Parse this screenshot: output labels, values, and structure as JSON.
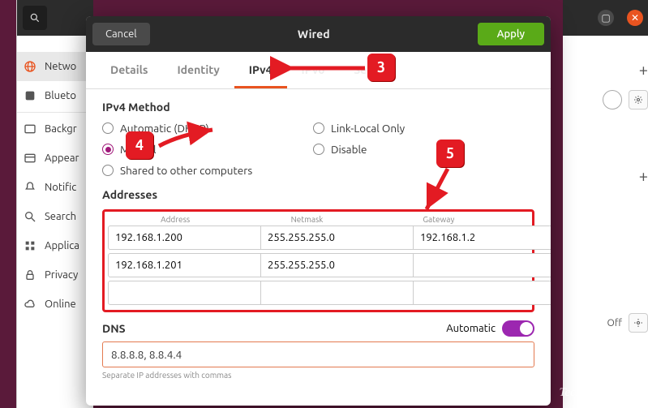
{
  "sidebar": {
    "items": [
      {
        "label": "Netwo",
        "icon": "globe"
      },
      {
        "label": "Blueto",
        "icon": "bluetooth"
      },
      {
        "label": "Backgr",
        "icon": "background"
      },
      {
        "label": "Appear",
        "icon": "appearance"
      },
      {
        "label": "Notific",
        "icon": "bell"
      },
      {
        "label": "Search",
        "icon": "search"
      },
      {
        "label": "Applica",
        "icon": "apps"
      },
      {
        "label": "Privacy",
        "icon": "lock"
      },
      {
        "label": "Online",
        "icon": "cloud"
      }
    ]
  },
  "dialog": {
    "cancel": "Cancel",
    "title": "Wired",
    "apply": "Apply"
  },
  "tabs": {
    "details": "Details",
    "identity": "Identity",
    "ipv4": "IPv4",
    "ipv6": "IPv6",
    "security": "Sec"
  },
  "ipv4": {
    "method_label": "IPv4 Method",
    "methods": {
      "auto": "Automatic (DHCP)",
      "link": "Link-Local Only",
      "manual": "Manual",
      "disable": "Disable",
      "shared": "Shared to other computers"
    },
    "addresses_label": "Addresses",
    "columns": {
      "address": "Address",
      "netmask": "Netmask",
      "gateway": "Gateway"
    },
    "rows": [
      {
        "address": "192.168.1.200",
        "netmask": "255.255.255.0",
        "gateway": "192.168.1.2"
      },
      {
        "address": "192.168.1.201",
        "netmask": "255.255.255.0",
        "gateway": ""
      },
      {
        "address": "",
        "netmask": "",
        "gateway": ""
      }
    ],
    "dns_label": "DNS",
    "dns_auto": "Automatic",
    "dns_value": "8.8.8.8, 8.8.4.4",
    "dns_hint": "Separate IP addresses with commas"
  },
  "right": {
    "off": "Off"
  },
  "badges": {
    "b3": "3",
    "b4": "4",
    "b5": "5"
  },
  "watermark": "TecAdmin.net"
}
